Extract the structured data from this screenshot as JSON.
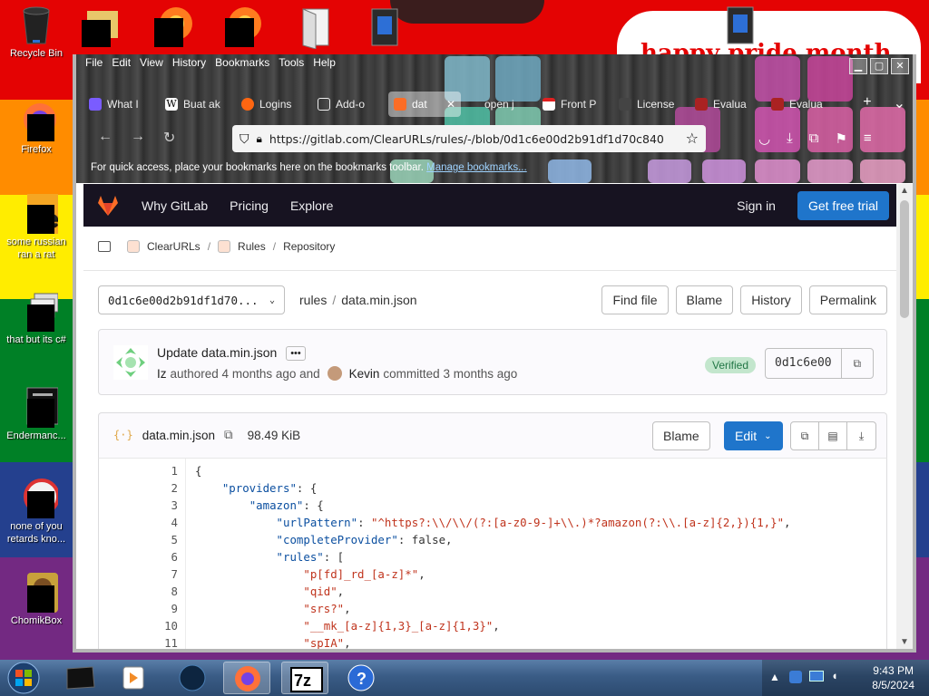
{
  "desktop": {
    "banner_text": "happy pride month",
    "icons": [
      {
        "label": "Recycle Bin"
      },
      {
        "label": "Firefox"
      },
      {
        "label": "some russian ran a rat"
      },
      {
        "label": "that but its c#"
      },
      {
        "label": "Endermanc..."
      },
      {
        "label": "none of you retards kno..."
      },
      {
        "label": "ChomikBox"
      }
    ]
  },
  "browser": {
    "menu": [
      "File",
      "Edit",
      "View",
      "History",
      "Bookmarks",
      "Tools",
      "Help"
    ],
    "tabs": [
      {
        "label": "What I",
        "color": "#7a5cff"
      },
      {
        "label": "Buat ak",
        "color": "#ffffff"
      },
      {
        "label": "Logins",
        "color": "#ff6611"
      },
      {
        "label": "Add-o",
        "color": "#eeeeee"
      },
      {
        "label": "dat",
        "color": "#fc6d26",
        "active": true
      },
      {
        "label": "open j",
        "color": "#888888"
      },
      {
        "label": "Front P",
        "color": "#e02020"
      },
      {
        "label": "License",
        "color": "#444444"
      },
      {
        "label": "Evalua",
        "color": "#aa2222"
      },
      {
        "label": "Evalua",
        "color": "#aa2222"
      }
    ],
    "url": "https://gitlab.com/ClearURLs/rules/-/blob/0d1c6e00d2b91df1d70c840",
    "bookmarks_hint": "For quick access, place your bookmarks here on the bookmarks toolbar.",
    "bookmarks_link": "Manage bookmarks..."
  },
  "gitlab": {
    "nav": {
      "why": "Why GitLab",
      "pricing": "Pricing",
      "explore": "Explore",
      "signin": "Sign in",
      "trial": "Get free trial"
    },
    "breadcrumb": [
      "ClearURLs",
      "Rules",
      "Repository"
    ],
    "ref": "0d1c6e00d2b91df1d70...",
    "path": [
      "rules",
      "data.min.json"
    ],
    "actions": [
      "Find file",
      "Blame",
      "History",
      "Permalink"
    ],
    "commit": {
      "message": "Update data.min.json",
      "dots": "•••",
      "author": "Iz",
      "authored_text": "authored 4 months ago and",
      "committer": "Kevin",
      "committed_text": "committed 3 months ago",
      "verified": "Verified",
      "sha": "0d1c6e00"
    },
    "file": {
      "name": "data.min.json",
      "size": "98.49 KiB",
      "blame": "Blame",
      "edit": "Edit"
    },
    "code_lines": [
      {
        "n": "1",
        "parts": [
          [
            "p",
            "{"
          ]
        ]
      },
      {
        "n": "2",
        "parts": [
          [
            "p",
            "    "
          ],
          [
            "k",
            "\"providers\""
          ],
          [
            "p",
            ": {"
          ]
        ]
      },
      {
        "n": "3",
        "parts": [
          [
            "p",
            "        "
          ],
          [
            "k",
            "\"amazon\""
          ],
          [
            "p",
            ": {"
          ]
        ]
      },
      {
        "n": "4",
        "parts": [
          [
            "p",
            "            "
          ],
          [
            "k",
            "\"urlPattern\""
          ],
          [
            "p",
            ": "
          ],
          [
            "s",
            "\"^https?:\\\\/\\\\/(?:[a-z0-9-]+\\\\.)*?amazon(?:\\\\.[a-z]{2,}){1,}\""
          ],
          [
            "p",
            ","
          ]
        ]
      },
      {
        "n": "5",
        "parts": [
          [
            "p",
            "            "
          ],
          [
            "k",
            "\"completeProvider\""
          ],
          [
            "p",
            ": false,"
          ]
        ]
      },
      {
        "n": "6",
        "parts": [
          [
            "p",
            "            "
          ],
          [
            "k",
            "\"rules\""
          ],
          [
            "p",
            ": ["
          ]
        ]
      },
      {
        "n": "7",
        "parts": [
          [
            "p",
            "                "
          ],
          [
            "s",
            "\"p[fd]_rd_[a-z]*\""
          ],
          [
            "p",
            ","
          ]
        ]
      },
      {
        "n": "8",
        "parts": [
          [
            "p",
            "                "
          ],
          [
            "s",
            "\"qid\""
          ],
          [
            "p",
            ","
          ]
        ]
      },
      {
        "n": "9",
        "parts": [
          [
            "p",
            "                "
          ],
          [
            "s",
            "\"srs?\""
          ],
          [
            "p",
            ","
          ]
        ]
      },
      {
        "n": "10",
        "parts": [
          [
            "p",
            "                "
          ],
          [
            "s",
            "\"__mk_[a-z]{1,3}_[a-z]{1,3}\""
          ],
          [
            "p",
            ","
          ]
        ]
      },
      {
        "n": "11",
        "parts": [
          [
            "p",
            "                "
          ],
          [
            "s",
            "\"spIA\""
          ],
          [
            "p",
            ","
          ]
        ]
      }
    ]
  },
  "taskbar": {
    "time": "9:43 PM",
    "date": "8/5/2024"
  },
  "colors": {
    "gitlab_nav": "#171321",
    "primary": "#1f75cb",
    "verified_bg": "#c3e6cd",
    "json_key": "#0b4fa0",
    "json_string": "#c0341d"
  }
}
